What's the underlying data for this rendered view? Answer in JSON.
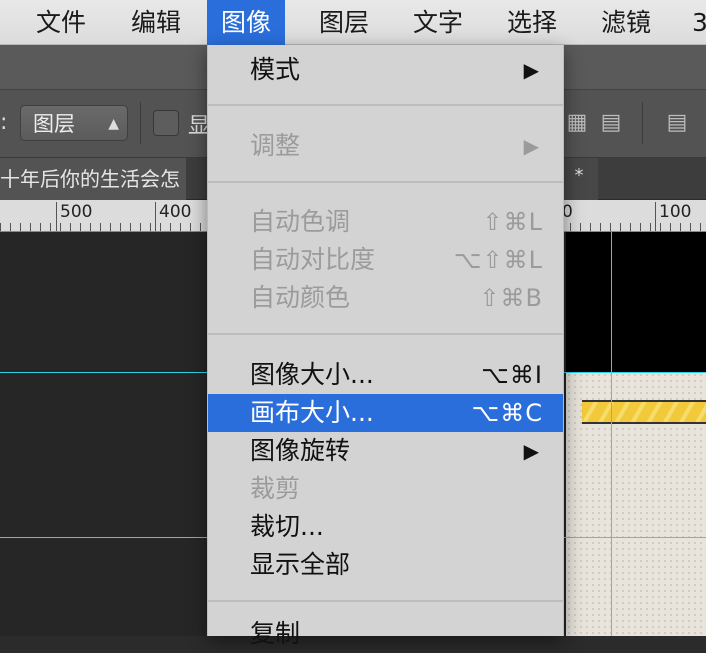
{
  "menubar": {
    "items": [
      "文件",
      "编辑",
      "图像",
      "图层",
      "文字",
      "选择",
      "滤镜",
      "3"
    ],
    "active_index": 2
  },
  "options_bar": {
    "label_colon": ":",
    "layer_select_value": "图层",
    "checkbox_label": "显"
  },
  "document": {
    "tab_title": "十年后你的生活会怎",
    "second_tab": "*"
  },
  "ruler": {
    "labels": [
      "500",
      "400",
      "0",
      "100"
    ]
  },
  "menu": {
    "items": [
      {
        "label": "模式",
        "shortcut": "",
        "submenu": true,
        "enabled": true
      },
      {
        "label": "调整",
        "shortcut": "",
        "submenu": true,
        "enabled": false
      },
      {
        "label": "自动色调",
        "shortcut": "⇧⌘L",
        "submenu": false,
        "enabled": false
      },
      {
        "label": "自动对比度",
        "shortcut": "⌥⇧⌘L",
        "submenu": false,
        "enabled": false
      },
      {
        "label": "自动颜色",
        "shortcut": "⇧⌘B",
        "submenu": false,
        "enabled": false
      },
      {
        "label": "图像大小...",
        "shortcut": "⌥⌘I",
        "submenu": false,
        "enabled": true
      },
      {
        "label": "画布大小...",
        "shortcut": "⌥⌘C",
        "submenu": false,
        "enabled": true,
        "highlighted": true
      },
      {
        "label": "图像旋转",
        "shortcut": "",
        "submenu": true,
        "enabled": true
      },
      {
        "label": "裁剪",
        "shortcut": "",
        "submenu": false,
        "enabled": false
      },
      {
        "label": "裁切...",
        "shortcut": "",
        "submenu": false,
        "enabled": true
      },
      {
        "label": "显示全部",
        "shortcut": "",
        "submenu": false,
        "enabled": true
      },
      {
        "label": "复制",
        "shortcut": "",
        "submenu": false,
        "enabled": true
      }
    ],
    "submenu_arrow": "▶"
  },
  "colors": {
    "accent": "#2a6edb",
    "guide": "#2fd3e6"
  }
}
